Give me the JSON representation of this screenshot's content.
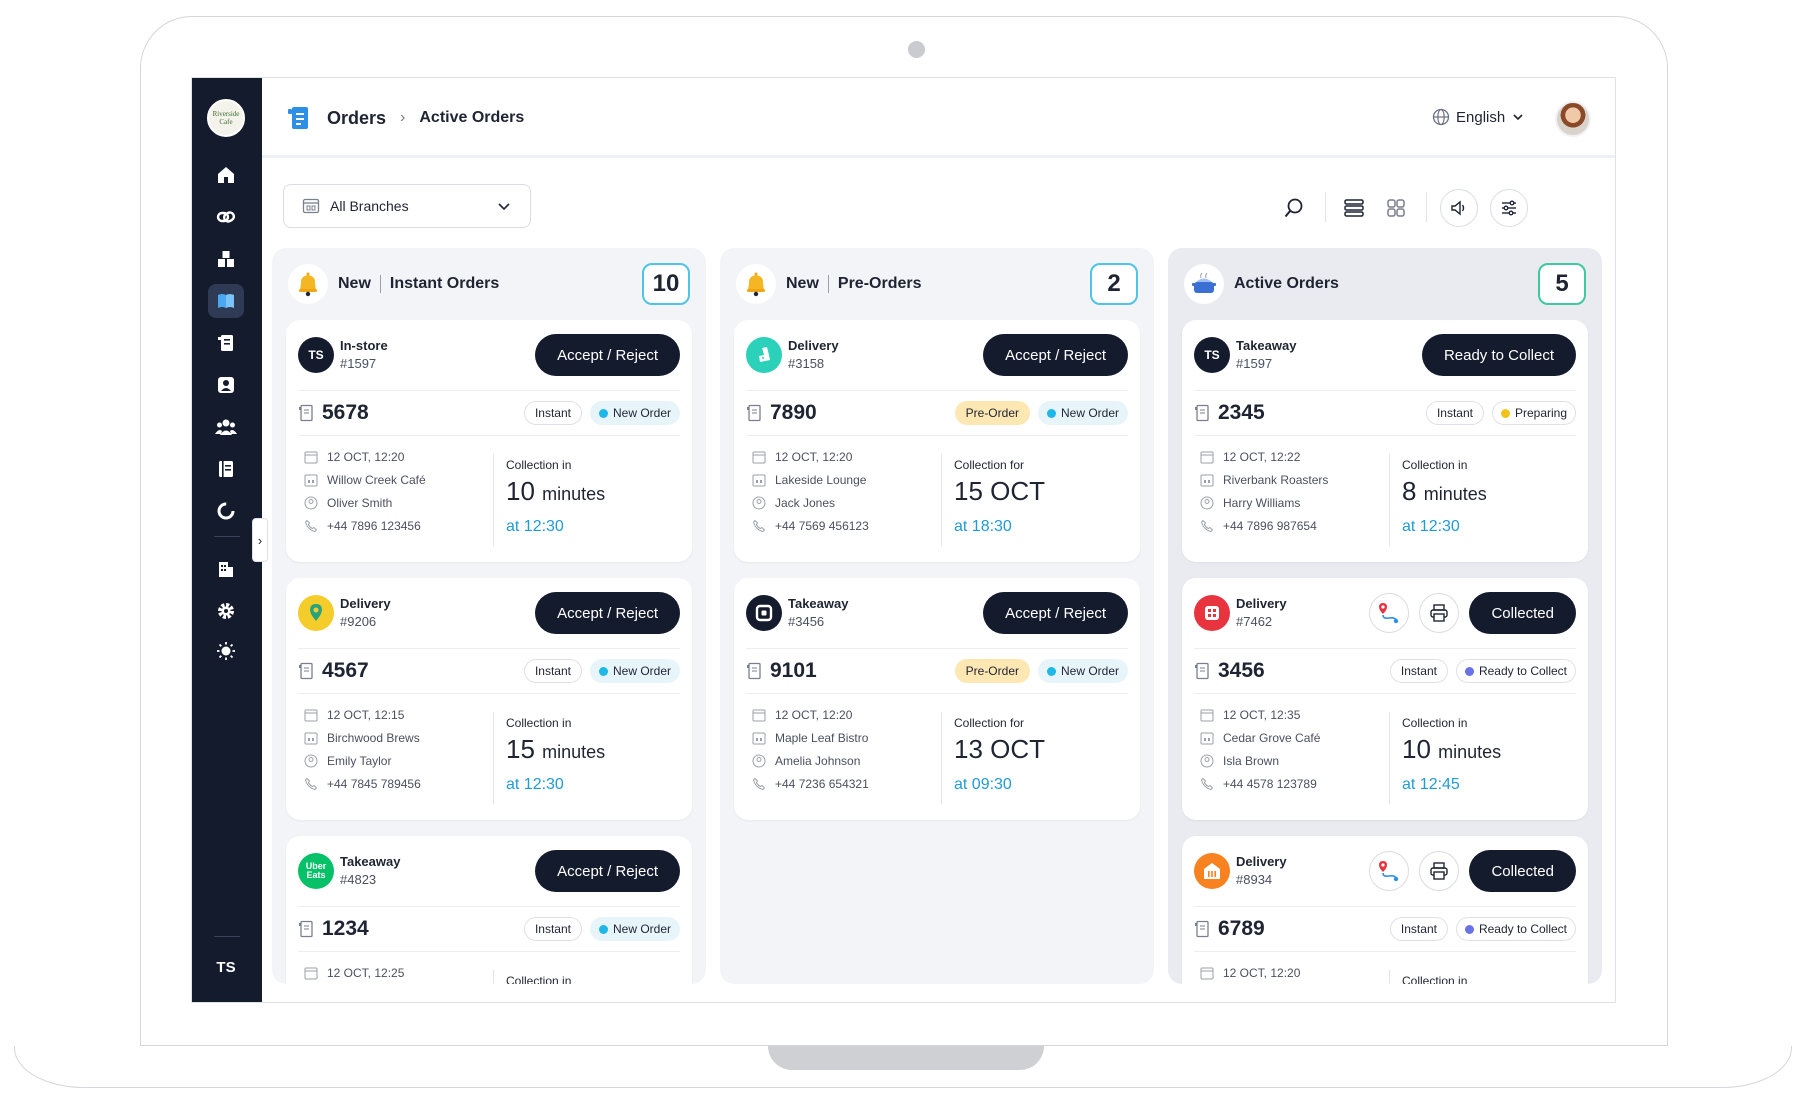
{
  "sidebar": {
    "logo_text": "Riverside Cafe",
    "footer_logo": "TS"
  },
  "header": {
    "breadcrumb_root": "Orders",
    "breadcrumb_current": "Active Orders",
    "language": "English"
  },
  "filters": {
    "branch": "All Branches"
  },
  "columns": [
    {
      "title_a": "New",
      "title_b": "Instant Orders",
      "count": "10",
      "cards": [
        {
          "type": "In-store",
          "id": "#1597",
          "action": "Accept / Reject",
          "number": "5678",
          "mode": "Instant",
          "status": "New Order",
          "date": "12 OCT, 12:20",
          "place": "Willow Creek Café",
          "person": "Oliver Smith",
          "phone": "+44 7896 123456",
          "coll_label": "Collection in",
          "coll_value": "10",
          "coll_unit": "minutes",
          "coll_at": "at 12:30"
        },
        {
          "type": "Delivery",
          "id": "#9206",
          "action": "Accept / Reject",
          "number": "4567",
          "mode": "Instant",
          "status": "New Order",
          "date": "12 OCT, 12:15",
          "place": "Birchwood Brews",
          "person": "Emily Taylor",
          "phone": "+44 7845 789456",
          "coll_label": "Collection in",
          "coll_value": "15",
          "coll_unit": "minutes",
          "coll_at": "at 12:30"
        },
        {
          "type": "Takeaway",
          "id": "#4823",
          "action": "Accept / Reject",
          "number": "1234",
          "mode": "Instant",
          "status": "New Order",
          "date": "12 OCT, 12:25",
          "place": "",
          "person": "",
          "phone": "",
          "coll_label": "Collection in",
          "coll_value": "",
          "coll_unit": "",
          "coll_at": ""
        }
      ]
    },
    {
      "title_a": "New",
      "title_b": "Pre-Orders",
      "count": "2",
      "cards": [
        {
          "type": "Delivery",
          "id": "#3158",
          "action": "Accept / Reject",
          "number": "7890",
          "mode": "Pre-Order",
          "status": "New Order",
          "date": "12 OCT, 12:20",
          "place": "Lakeside Lounge",
          "person": "Jack Jones",
          "phone": "+44 7569 456123",
          "coll_label": "Collection for",
          "coll_value": "15 OCT",
          "coll_unit": "",
          "coll_at": "at 18:30"
        },
        {
          "type": "Takeaway",
          "id": "#3456",
          "action": "Accept / Reject",
          "number": "9101",
          "mode": "Pre-Order",
          "status": "New Order",
          "date": "12 OCT, 12:20",
          "place": "Maple Leaf Bistro",
          "person": "Amelia Johnson",
          "phone": "+44 7236 654321",
          "coll_label": "Collection for",
          "coll_value": "13 OCT",
          "coll_unit": "",
          "coll_at": "at 09:30"
        }
      ]
    },
    {
      "title_a": "Active Orders",
      "title_b": "",
      "count": "5",
      "cards": [
        {
          "type": "Takeaway",
          "id": "#1597",
          "action": "Ready to Collect",
          "number": "2345",
          "mode": "Instant",
          "status": "Preparing",
          "date": "12 OCT, 12:22",
          "place": "Riverbank Roasters",
          "person": "Harry Williams",
          "phone": "+44 7896 987654",
          "coll_label": "Collection in",
          "coll_value": "8",
          "coll_unit": "minutes",
          "coll_at": "at 12:30"
        },
        {
          "type": "Delivery",
          "id": "#7462",
          "action": "Collected",
          "number": "3456",
          "mode": "Instant",
          "status": "Ready to Collect",
          "date": "12 OCT, 12:35",
          "place": "Cedar Grove Café",
          "person": "Isla Brown",
          "phone": "+44 4578 123789",
          "coll_label": "Collection in",
          "coll_value": "10",
          "coll_unit": "minutes",
          "coll_at": "at 12:45"
        },
        {
          "type": "Delivery",
          "id": "#8934",
          "action": "Collected",
          "number": "6789",
          "mode": "Instant",
          "status": "Ready to Collect",
          "date": "12 OCT, 12:20",
          "place": "",
          "person": "",
          "phone": "",
          "coll_label": "Collection in",
          "coll_value": "",
          "coll_unit": "",
          "coll_at": ""
        }
      ]
    }
  ],
  "brands": {
    "uber_eats": "Uber Eats"
  },
  "colors": {
    "sidebar": "#141b2d",
    "accent": "#1f9bd6",
    "new_order_dot": "#1fb6e8",
    "preparing_dot": "#f2c21b",
    "ready_dot": "#6a70e8",
    "pre_order_tag": "#fde7b3"
  }
}
